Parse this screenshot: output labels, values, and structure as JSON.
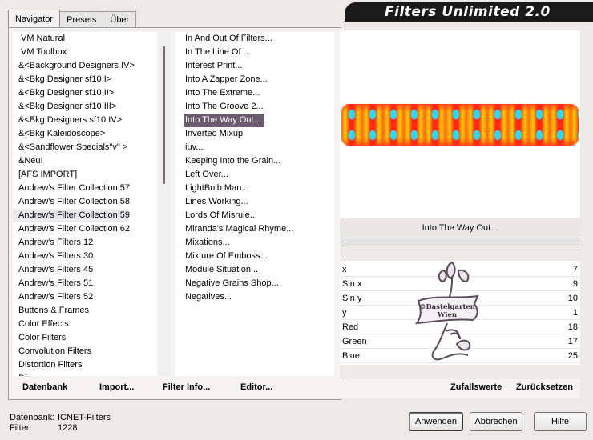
{
  "tabs": [
    {
      "label": "Navigator",
      "active": true
    },
    {
      "label": "Presets",
      "active": false
    },
    {
      "label": "Über",
      "active": false
    }
  ],
  "title": "Filters Unlimited 2.0",
  "categories": [
    "VM Natural",
    "VM Toolbox",
    "&<Background Designers IV>",
    "&<Bkg Designer sf10 I>",
    "&<Bkg Designer sf10 II>",
    "&<Bkg Designer sf10 III>",
    "&<Bkg Designers sf10 IV>",
    "&<Bkg Kaleidoscope>",
    "&<Sandflower Specials\"v\" >",
    "&Neu!",
    "[AFS IMPORT]",
    "Andrew's Filter Collection 57",
    "Andrew's Filter Collection 58",
    "Andrew's Filter Collection 59",
    "Andrew's Filter Collection 62",
    "Andrew's Filters 12",
    "Andrew's Filters 30",
    "Andrew's Filters 45",
    "Andrew's Filters 51",
    "Andrew's Filters 52",
    "Buttons & Frames",
    "Color Effects",
    "Color Filters",
    "Convolution Filters",
    "Distortion Filters",
    "Dis..."
  ],
  "selected_category_index": 13,
  "filters": [
    "In And Out Of Filters...",
    "In The Line Of ...",
    "Interest Print...",
    "Into A Zapper Zone...",
    "Into The Extreme...",
    "Into The Groove 2...",
    "Into The Way Out...",
    "Inverted Mixup",
    "iuv...",
    "Keeping Into the Grain...",
    "Left Over...",
    "LightBulb Man...",
    "Lines Working...",
    "Lords Of Misrule...",
    "Miranda's Magical Rhyme...",
    "Mixations...",
    "Mixture Of Emboss...",
    "Module Situation...",
    "Negative Grains Shop...",
    "Negatives..."
  ],
  "selected_filter_index": 6,
  "bottom_left": {
    "datenbank": "Datenbank",
    "import": "Import...",
    "filter_info": "Filter Info...",
    "editor": "Editor..."
  },
  "selected_filter_name": "Into The Way Out...",
  "params": [
    {
      "label": "x",
      "value": "7"
    },
    {
      "label": "Sin x",
      "value": "9"
    },
    {
      "label": "Sin y",
      "value": "10"
    },
    {
      "label": "y",
      "value": "1"
    },
    {
      "label": "Red",
      "value": "18"
    },
    {
      "label": "Green",
      "value": "17"
    },
    {
      "label": "Blue",
      "value": "25"
    }
  ],
  "watermark": {
    "line1": "©Bastelgarten",
    "line2": "Wien"
  },
  "bottom_right": {
    "random": "Zufallswerte",
    "reset": "Zurücksetzen"
  },
  "status": {
    "db_label": "Datenbank:",
    "db_value": "ICNET-Filters",
    "filter_label": "Filter:",
    "filter_value": "1228"
  },
  "buttons": {
    "apply": "Anwenden",
    "cancel": "Abbrechen",
    "help": "Hilfe"
  },
  "colors": {
    "selection": "#6b5b6e",
    "banner": "#1a1a1a"
  }
}
